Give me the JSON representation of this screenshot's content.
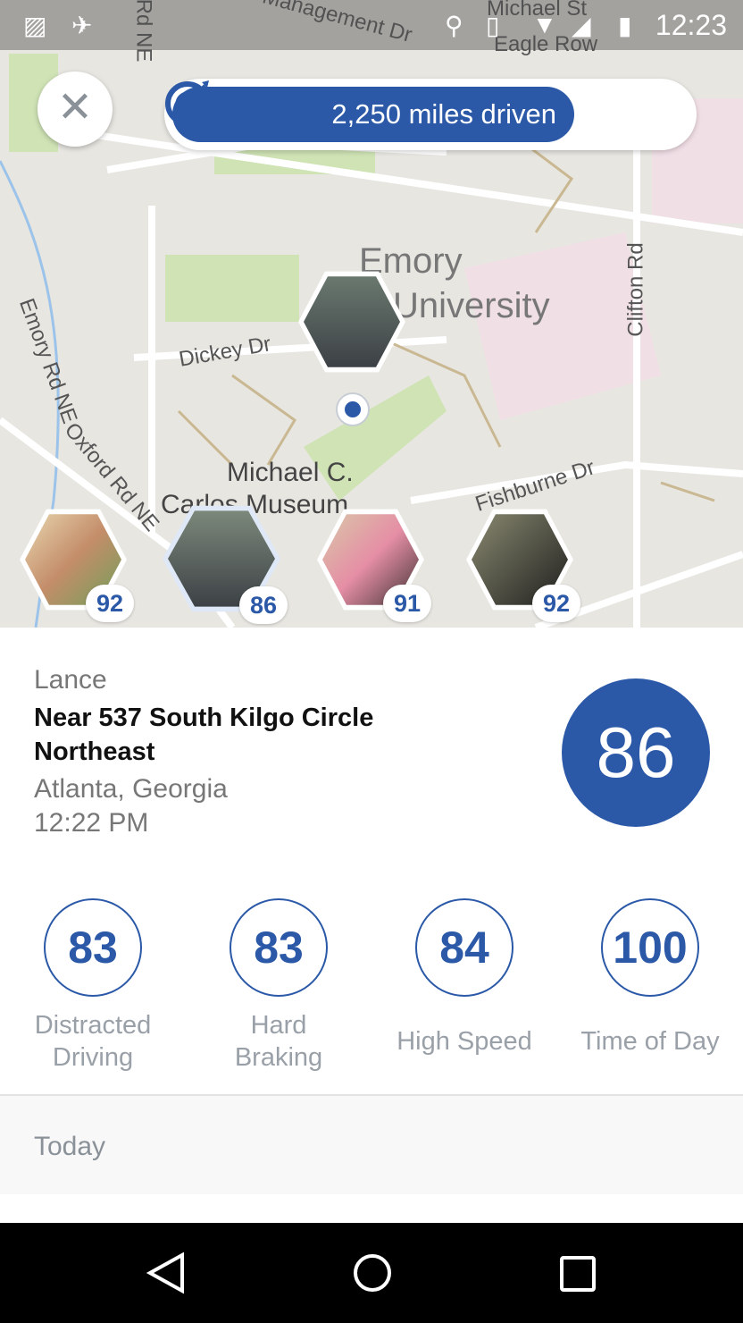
{
  "status_bar": {
    "time": "12:23",
    "icons": [
      "image-icon",
      "fake-gps-icon",
      "location-icon",
      "vibrate-icon",
      "wifi-icon",
      "signal-icon",
      "battery-charging-icon"
    ]
  },
  "map": {
    "labels": [
      "Emory",
      "University",
      "Dickey Dr",
      "Emory Rd NE",
      "Oxford Rd NE",
      "Michael C.",
      "Carlos Museum",
      "Clifton Rd",
      "Eagle Row",
      "Michael St",
      "Fishburne Dr",
      "Rd NE",
      "es Management Dr"
    ]
  },
  "header": {
    "miles": "2,250 miles driven",
    "close_icon": "close-icon",
    "goal_icon": "target-icon"
  },
  "members": [
    {
      "score": "92"
    },
    {
      "score": "86"
    },
    {
      "score": "91"
    },
    {
      "score": "92"
    }
  ],
  "details": {
    "name": "Lance",
    "address": "Near 537 South Kilgo Circle Northeast",
    "city": "Atlanta, Georgia",
    "time": "12:22 PM",
    "score": "86"
  },
  "metrics": [
    {
      "value": "83",
      "label": "Distracted Driving"
    },
    {
      "value": "83",
      "label": "Hard Braking"
    },
    {
      "value": "84",
      "label": "High Speed"
    },
    {
      "value": "100",
      "label": "Time of Day"
    }
  ],
  "today": "Today",
  "colors": {
    "accent": "#2b59a8"
  }
}
